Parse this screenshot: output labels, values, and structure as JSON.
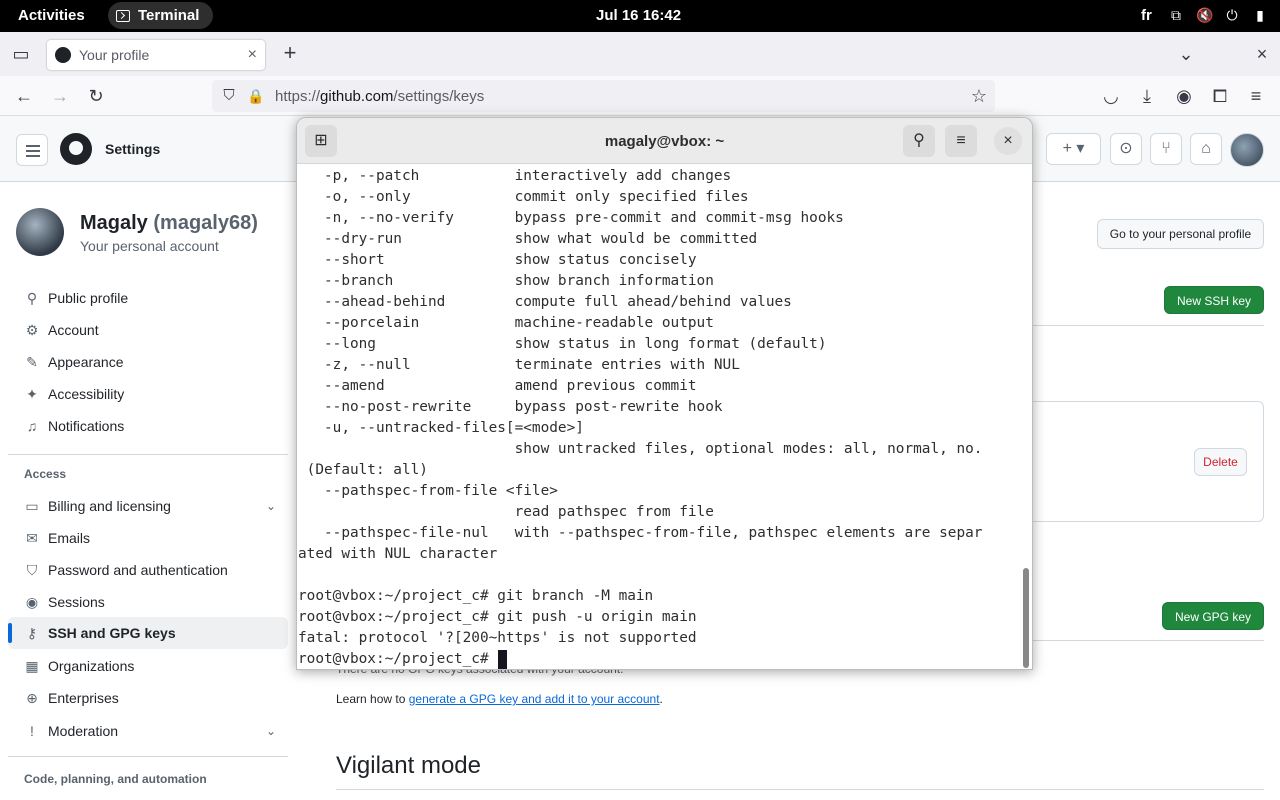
{
  "topbar": {
    "activities": "Activities",
    "app_name": "Terminal",
    "clock": "Jul 16  16:42",
    "lang": "fr"
  },
  "browser": {
    "tab_title": "Your profile",
    "url_prefix": "https://",
    "url_domain": "github.com",
    "url_path": "/settings/keys"
  },
  "github": {
    "header_title": "Settings",
    "profile": {
      "name": "Magaly",
      "handle": "(magaly68)",
      "subtitle": "Your personal account"
    },
    "sidebar": {
      "items": [
        {
          "label": "Public profile",
          "icon": "person-icon"
        },
        {
          "label": "Account",
          "icon": "gear-icon"
        },
        {
          "label": "Appearance",
          "icon": "paintbrush-icon"
        },
        {
          "label": "Accessibility",
          "icon": "accessibility-icon"
        },
        {
          "label": "Notifications",
          "icon": "bell-icon"
        }
      ],
      "access_heading": "Access",
      "access_items": [
        {
          "label": "Billing and licensing",
          "icon": "credit-card-icon"
        },
        {
          "label": "Emails",
          "icon": "mail-icon"
        },
        {
          "label": "Password and authentication",
          "icon": "shield-lock-icon"
        },
        {
          "label": "Sessions",
          "icon": "broadcast-icon"
        },
        {
          "label": "SSH and GPG keys",
          "icon": "key-icon"
        },
        {
          "label": "Organizations",
          "icon": "organization-icon"
        },
        {
          "label": "Enterprises",
          "icon": "globe-icon"
        },
        {
          "label": "Moderation",
          "icon": "report-icon"
        }
      ],
      "code_heading": "Code, planning, and automation"
    },
    "main": {
      "go_profile_button": "Go to your personal profile",
      "new_ssh_button": "New SSH key",
      "delete_button": "Delete",
      "new_gpg_button": "New GPG key",
      "gpg_note": "There are no GPG keys associated with your account.",
      "learn_prefix": "Learn how to ",
      "learn_link": "generate a GPG key and add it to your account",
      "learn_suffix": ".",
      "vigilant_heading": "Vigilant mode"
    }
  },
  "terminal": {
    "title": "magaly@vbox: ~",
    "lines": [
      "   -p, --patch           interactively add changes",
      "   -o, --only            commit only specified files",
      "   -n, --no-verify       bypass pre-commit and commit-msg hooks",
      "   --dry-run             show what would be committed",
      "   --short               show status concisely",
      "   --branch              show branch information",
      "   --ahead-behind        compute full ahead/behind values",
      "   --porcelain           machine-readable output",
      "   --long                show status in long format (default)",
      "   -z, --null            terminate entries with NUL",
      "   --amend               amend previous commit",
      "   --no-post-rewrite     bypass post-rewrite hook",
      "   -u, --untracked-files[=<mode>]",
      "                         show untracked files, optional modes: all, normal, no.",
      " (Default: all)",
      "   --pathspec-from-file <file>",
      "                         read pathspec from file",
      "   --pathspec-file-nul   with --pathspec-from-file, pathspec elements are separ",
      "ated with NUL character",
      "",
      "root@vbox:~/project_c# git branch -M main",
      "root@vbox:~/project_c# git push -u origin main",
      "fatal: protocol '?[200~https' is not supported",
      "root@vbox:~/project_c# "
    ]
  }
}
